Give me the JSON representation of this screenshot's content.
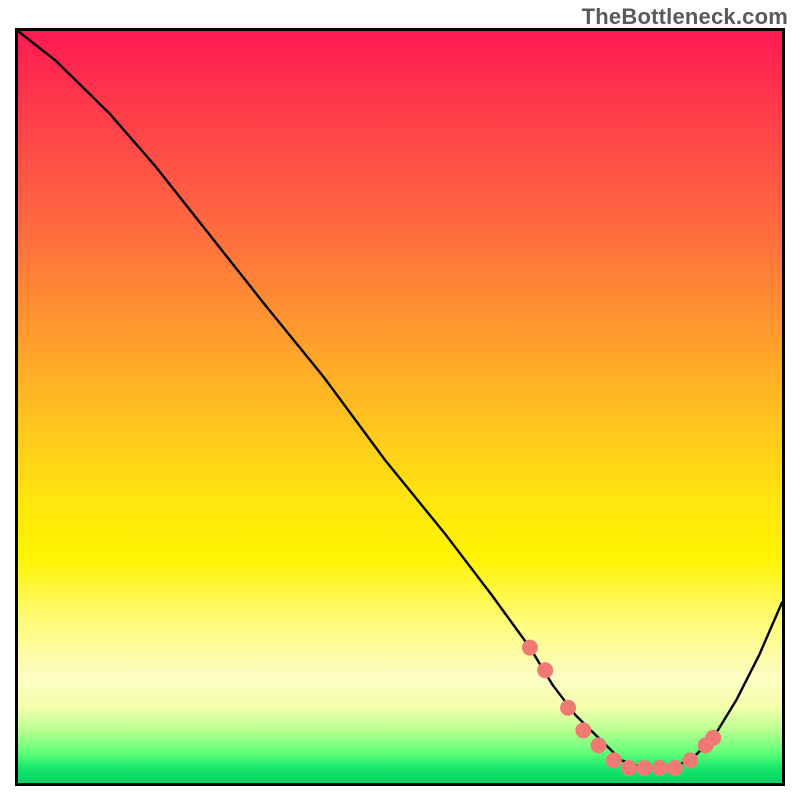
{
  "watermark": "TheBottleneck.com",
  "chart_data": {
    "type": "line",
    "title": "",
    "xlabel": "",
    "ylabel": "",
    "xlim": [
      0,
      100
    ],
    "ylim": [
      0,
      100
    ],
    "grid": false,
    "legend": false,
    "annotations": [],
    "background_gradient": {
      "direction": "vertical",
      "stops": [
        {
          "pos": 0.0,
          "color": "#ff1a53"
        },
        {
          "pos": 0.1,
          "color": "#ff3a4a"
        },
        {
          "pos": 0.26,
          "color": "#ff6a3f"
        },
        {
          "pos": 0.4,
          "color": "#ff9a2e"
        },
        {
          "pos": 0.52,
          "color": "#ffc41f"
        },
        {
          "pos": 0.62,
          "color": "#ffe40f"
        },
        {
          "pos": 0.7,
          "color": "#fff400"
        },
        {
          "pos": 0.78,
          "color": "#fffb74"
        },
        {
          "pos": 0.86,
          "color": "#fdfdc4"
        },
        {
          "pos": 0.9,
          "color": "#f2ffac"
        },
        {
          "pos": 0.93,
          "color": "#b8ff8e"
        },
        {
          "pos": 0.96,
          "color": "#61ff79"
        },
        {
          "pos": 0.98,
          "color": "#17e86a"
        },
        {
          "pos": 1.0,
          "color": "#0bcf66"
        }
      ]
    },
    "series": [
      {
        "name": "bottleneck-curve",
        "color": "#000000",
        "x": [
          0,
          5,
          12,
          18,
          25,
          32,
          40,
          48,
          56,
          62,
          67,
          70,
          73,
          76,
          79,
          82,
          85,
          88,
          91,
          94,
          97,
          100
        ],
        "y": [
          100,
          96,
          89,
          82,
          73,
          64,
          54,
          43,
          33,
          25,
          18,
          13,
          9,
          6,
          3,
          2,
          2,
          3,
          6,
          11,
          17,
          24
        ]
      }
    ],
    "markers": {
      "name": "highlight-points",
      "color": "#ef7a74",
      "x": [
        67,
        69,
        72,
        74,
        76,
        78,
        80,
        82,
        84,
        86,
        88,
        90,
        91
      ],
      "y": [
        18,
        15,
        10,
        7,
        5,
        3,
        2,
        2,
        2,
        2,
        3,
        5,
        6
      ]
    }
  }
}
